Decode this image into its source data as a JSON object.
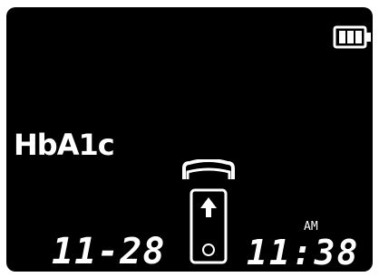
{
  "display": {
    "test_name": "HbA1c",
    "left_readout": "11-28",
    "time_readout": "11:38",
    "meridiem": "AM"
  },
  "icons": {
    "battery": "battery-full-icon",
    "cartridge": "test-cartridge-icon",
    "lid": "cartridge-lid-icon",
    "insert_arrow": "arrow-up-icon"
  },
  "battery_level": 1.0,
  "colors": {
    "background": "#000000",
    "foreground": "#ffffff"
  }
}
